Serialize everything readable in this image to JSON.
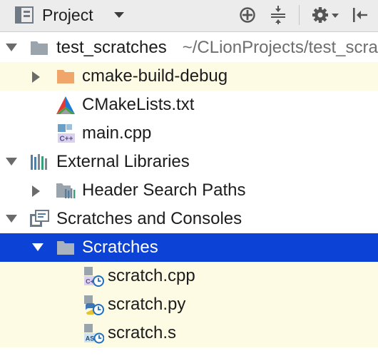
{
  "toolbar": {
    "title": "Project",
    "icons": [
      "project-view-icon",
      "dropdown-caret-icon",
      "locate-target-icon",
      "collapse-all-icon",
      "gear-icon",
      "hide-panel-icon"
    ]
  },
  "tree": {
    "project_root": {
      "label": "test_scratches",
      "path": "~/CLionProjects/test_scratches"
    },
    "cmake_build_debug": {
      "label": "cmake-build-debug"
    },
    "cmakelists": {
      "label": "CMakeLists.txt"
    },
    "main_cpp": {
      "label": "main.cpp",
      "badge": "C++"
    },
    "external_libraries": {
      "label": "External Libraries"
    },
    "header_search_paths": {
      "label": "Header Search Paths"
    },
    "scratches_and_consoles": {
      "label": "Scratches and Consoles"
    },
    "scratches": {
      "label": "Scratches"
    },
    "scratch_cpp": {
      "label": "scratch.cpp"
    },
    "scratch_py": {
      "label": "scratch.py"
    },
    "scratch_s": {
      "label": "scratch.s",
      "badge": "AS"
    }
  },
  "colors": {
    "toolbar_bg": "#ececec",
    "selection": "#0c42d6",
    "highlight_row": "#fdfbe4",
    "folder_orange": "#f0a56b",
    "folder_gray": "#9aa4ad"
  }
}
